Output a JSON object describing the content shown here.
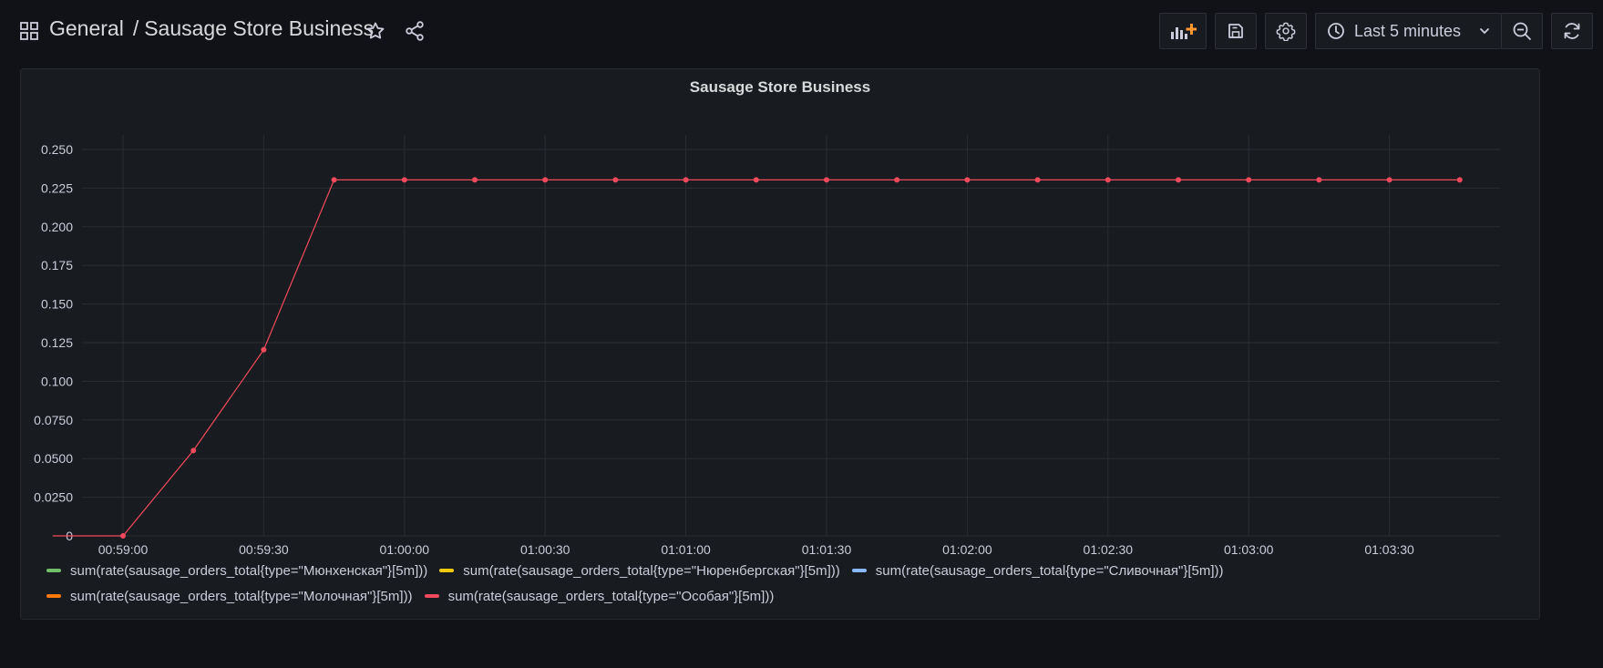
{
  "header": {
    "folder": "General",
    "separator": "/",
    "dashboard_title": "Sausage Store Business"
  },
  "toolbar": {
    "time_range": "Last 5 minutes"
  },
  "panel": {
    "title": "Sausage Store Business"
  },
  "chart_data": {
    "type": "line",
    "title": "Sausage Store Business",
    "xlabel": "",
    "ylabel": "",
    "ylim": [
      0,
      0.25
    ],
    "y_ticks": [
      "0",
      "0.0250",
      "0.0500",
      "0.0750",
      "0.100",
      "0.125",
      "0.150",
      "0.175",
      "0.200",
      "0.225",
      "0.250"
    ],
    "x_ticks": [
      "00:59:00",
      "00:59:30",
      "01:00:00",
      "01:00:30",
      "01:01:00",
      "01:01:30",
      "01:02:00",
      "01:02:30",
      "01:03:00",
      "01:03:30"
    ],
    "x": [
      "00:58:45",
      "00:59:00",
      "00:59:15",
      "00:59:30",
      "00:59:45",
      "01:00:00",
      "01:00:15",
      "01:00:30",
      "01:00:45",
      "01:01:00",
      "01:01:15",
      "01:01:30",
      "01:01:45",
      "01:02:00",
      "01:02:15",
      "01:02:30",
      "01:02:45",
      "01:03:00",
      "01:03:15",
      "01:03:30",
      "01:03:45"
    ],
    "grid": true,
    "legend_position": "bottom-left",
    "series": [
      {
        "name": "sum(rate(sausage_orders_total{type=\"Мюнхенская\"}[5m]))",
        "color": "#73bf69",
        "values": []
      },
      {
        "name": "sum(rate(sausage_orders_total{type=\"Нюренбергская\"}[5m]))",
        "color": "#f2cc0c",
        "values": []
      },
      {
        "name": "sum(rate(sausage_orders_total{type=\"Сливочная\"}[5m]))",
        "color": "#8ab8ff",
        "values": []
      },
      {
        "name": "sum(rate(sausage_orders_total{type=\"Молочная\"}[5m]))",
        "color": "#ff780a",
        "values": []
      },
      {
        "name": "sum(rate(sausage_orders_total{type=\"Особая\"}[5m]))",
        "color": "#f2495c",
        "values": [
          0,
          0,
          0.0552,
          0.1204,
          0.2303,
          0.2303,
          0.2303,
          0.2303,
          0.2303,
          0.2303,
          0.2303,
          0.2303,
          0.2303,
          0.2303,
          0.2303,
          0.2303,
          0.2303,
          0.2303,
          0.2303,
          0.2303,
          0.2303
        ],
        "points_start_index": 1
      }
    ]
  }
}
